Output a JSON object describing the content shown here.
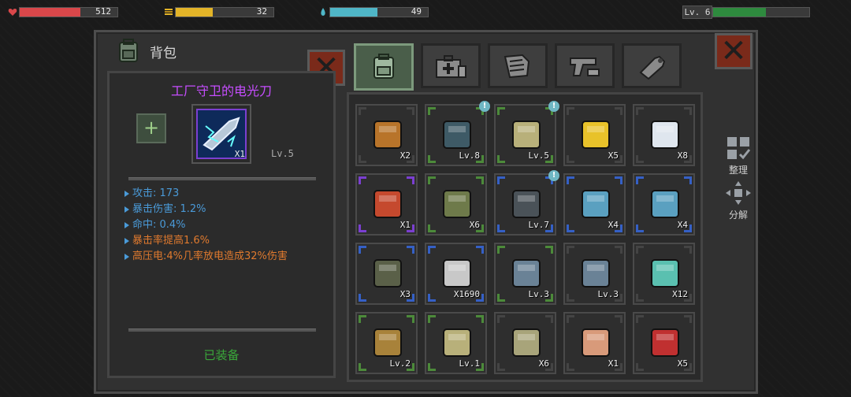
{
  "status": {
    "health": {
      "value": "512",
      "fraction": 0.62,
      "color": "#d9474a"
    },
    "food": {
      "value": "32",
      "fraction": 0.38,
      "color": "#e3b428"
    },
    "water": {
      "value": "49",
      "fraction": 0.48,
      "color": "#4fb6c7"
    },
    "level_label": "Lv. 6",
    "level_fraction": 0.55
  },
  "window": {
    "title": "背包",
    "item_name": "工厂守卫的电光刀",
    "item_count": "X1",
    "item_level": "Lv.5",
    "stats": [
      {
        "text": "攻击: 173",
        "color": "#4a9ad8"
      },
      {
        "text": "暴击伤害: 1.2%",
        "color": "#4a9ad8"
      },
      {
        "text": "命中: 0.4%",
        "color": "#4a9ad8"
      },
      {
        "text": "暴击率提高1.6%",
        "color": "#e07a2e"
      },
      {
        "text": "高压电:4%几率放电造成32%伤害",
        "color": "#e07a2e"
      }
    ],
    "equipped_label": "已装备"
  },
  "tabs": [
    {
      "icon": "backpack-icon",
      "active": true
    },
    {
      "icon": "medkit-icon",
      "active": false
    },
    {
      "icon": "armor-icon",
      "active": false
    },
    {
      "icon": "gun-icon",
      "active": false
    },
    {
      "icon": "wrench-icon",
      "active": false
    }
  ],
  "side_tools": {
    "organize": "整理",
    "decompose": "分解"
  },
  "inventory": [
    {
      "name": "burger",
      "label": "X2",
      "rarity": "#444444",
      "art": "#b8742a",
      "badge": false
    },
    {
      "name": "beanie",
      "label": "Lv.8",
      "rarity": "#4c8a3a",
      "art": "#3e5a66",
      "badge": true
    },
    {
      "name": "jacket",
      "label": "Lv.5",
      "rarity": "#4c8a3a",
      "art": "#b8b07a",
      "badge": true
    },
    {
      "name": "oil-can",
      "label": "X5",
      "rarity": "#444444",
      "art": "#e8c22a",
      "badge": false
    },
    {
      "name": "salt-bag",
      "label": "X8",
      "rarity": "#444444",
      "art": "#dfe6ee",
      "badge": false
    },
    {
      "name": "stew-bowl",
      "label": "X1",
      "rarity": "#7b3fd1",
      "art": "#c5492e",
      "badge": false
    },
    {
      "name": "med-pack",
      "label": "X6",
      "rarity": "#4c8a3a",
      "art": "#6e7a4a",
      "badge": false
    },
    {
      "name": "vest",
      "label": "Lv.7",
      "rarity": "#3560c6",
      "art": "#4a5258",
      "badge": true
    },
    {
      "name": "armor-case",
      "label": "X4",
      "rarity": "#3560c6",
      "art": "#5aa0c0",
      "badge": false
    },
    {
      "name": "gun-case",
      "label": "X4",
      "rarity": "#3560c6",
      "art": "#5aa0c0",
      "badge": false
    },
    {
      "name": "leg-armor",
      "label": "X3",
      "rarity": "#3560c6",
      "art": "#5a6048",
      "badge": false
    },
    {
      "name": "silver-coin",
      "label": "X1690",
      "rarity": "#3560c6",
      "art": "#c8c8c8",
      "badge": false
    },
    {
      "name": "jeans",
      "label": "Lv.3",
      "rarity": "#4c8a3a",
      "art": "#6a8296",
      "badge": false
    },
    {
      "name": "jeans-2",
      "label": "Lv.3",
      "rarity": "#444444",
      "art": "#6a8296",
      "badge": false
    },
    {
      "name": "water-bucket",
      "label": "X12",
      "rarity": "#444444",
      "art": "#5ac0b0",
      "badge": false
    },
    {
      "name": "boots",
      "label": "Lv.2",
      "rarity": "#4c8a3a",
      "art": "#a8823a",
      "badge": false
    },
    {
      "name": "jacket-2",
      "label": "Lv.1",
      "rarity": "#4c8a3a",
      "art": "#b8b07a",
      "badge": false
    },
    {
      "name": "cloth",
      "label": "X6",
      "rarity": "#444444",
      "art": "#a8a47a",
      "badge": false
    },
    {
      "name": "copper",
      "label": "X1",
      "rarity": "#444444",
      "art": "#d89a7a",
      "badge": false
    },
    {
      "name": "wire",
      "label": "X5",
      "rarity": "#444444",
      "art": "#c03030",
      "badge": false
    }
  ]
}
